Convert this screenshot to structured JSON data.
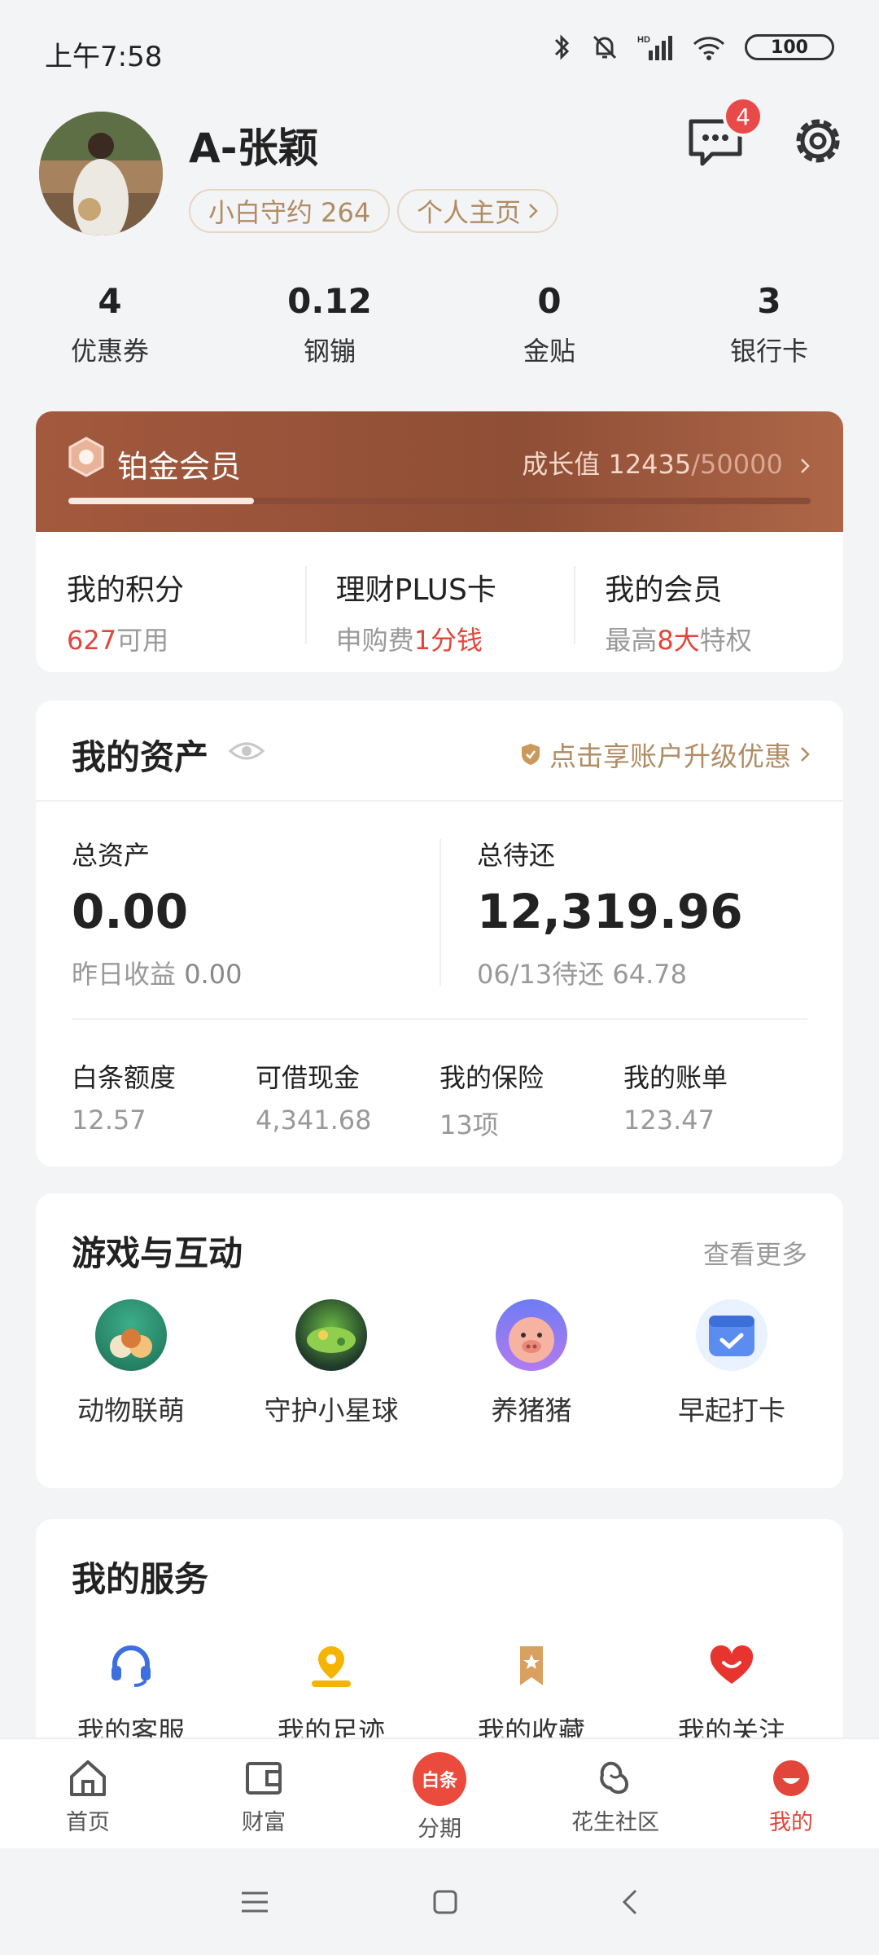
{
  "status": {
    "time": "上午7:58",
    "battery": "100"
  },
  "profile": {
    "name": "A-张颖",
    "pill1": "小白守约 264",
    "pill2": "个人主页",
    "messages_badge": "4"
  },
  "stats": [
    {
      "num": "4",
      "label": "优惠券"
    },
    {
      "num": "0.12",
      "label": "钢镚"
    },
    {
      "num": "0",
      "label": "金贴"
    },
    {
      "num": "3",
      "label": "银行卡"
    }
  ],
  "member": {
    "title": "铂金会员",
    "growth_label": "成长值",
    "growth_value": "12435",
    "growth_max": "/50000",
    "growth_fraction": 0.25,
    "cols": [
      {
        "title": "我的积分",
        "sub_red": "627",
        "sub": "可用"
      },
      {
        "title": "理财PLUS卡",
        "sub": "申购费",
        "sub_red": "1分钱"
      },
      {
        "title": "我的会员",
        "sub": "最高",
        "sub_red": "8大",
        "sub_tail": "特权"
      }
    ]
  },
  "assets": {
    "title": "我的资产",
    "upgrade": "点击享账户升级优惠",
    "total_label": "总资产",
    "total_value": "0.00",
    "yesterday": "昨日收益",
    "yesterday_value": "0.00",
    "due_label": "总待还",
    "due_value": "12,319.96",
    "due_note": "06/13待还 64.78",
    "items": [
      {
        "label": "白条额度",
        "value": "12.57"
      },
      {
        "label": "可借现金",
        "value": "4,341.68"
      },
      {
        "label": "我的保险",
        "value": "13项"
      },
      {
        "label": "我的账单",
        "value": "123.47"
      }
    ]
  },
  "games": {
    "title": "游戏与互动",
    "more": "查看更多",
    "items": [
      "动物联萌",
      "守护小星球",
      "养猪猪",
      "早起打卡"
    ]
  },
  "services": {
    "title": "我的服务",
    "items": [
      "我的客服",
      "我的足迹",
      "我的收藏",
      "我的关注"
    ]
  },
  "nav": {
    "items": [
      "首页",
      "财富",
      "分期",
      "花生社区",
      "我的"
    ],
    "center_badge": "白条"
  }
}
